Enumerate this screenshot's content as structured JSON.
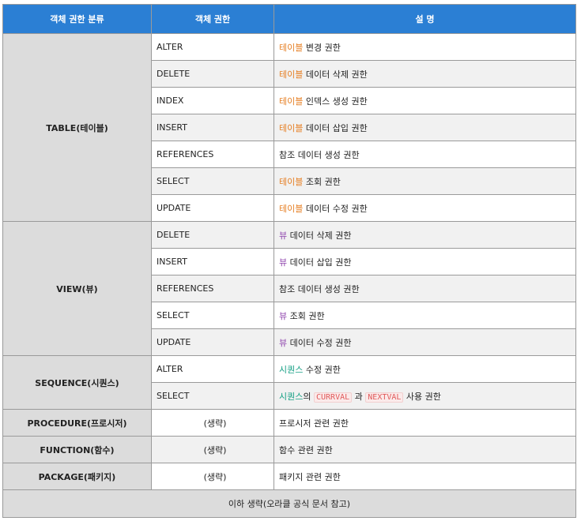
{
  "header": {
    "col1": "객체 권한 분류",
    "col2": "객체 권한",
    "col3": "설 명"
  },
  "colors": {
    "header_bg": "#2b7fd4",
    "table": "#e67e22",
    "view": "#8e44ad",
    "sequence": "#16a085",
    "code": "#e05a5a"
  },
  "table": {
    "category": "TABLE(테이블)",
    "rows": [
      {
        "priv": "ALTER",
        "hl": "테이블",
        "rest": " 변경 권한"
      },
      {
        "priv": "DELETE",
        "hl": "테이블",
        "rest": " 데이터 삭제 권한"
      },
      {
        "priv": "INDEX",
        "hl": "테이블",
        "rest": " 인덱스 생성 권한"
      },
      {
        "priv": "INSERT",
        "hl": "테이블",
        "rest": " 데이터 삽입 권한"
      },
      {
        "priv": "REFERENCES",
        "hl": "",
        "rest": "참조 데이터 생성 권한"
      },
      {
        "priv": "SELECT",
        "hl": "테이블",
        "rest": " 조회 권한"
      },
      {
        "priv": "UPDATE",
        "hl": "테이블",
        "rest": " 데이터 수정 권한"
      }
    ]
  },
  "view": {
    "category": "VIEW(뷰)",
    "rows": [
      {
        "priv": "DELETE",
        "hl": "뷰",
        "rest": " 데이터 삭제 권한"
      },
      {
        "priv": "INSERT",
        "hl": "뷰",
        "rest": " 데이터 삽입 권한"
      },
      {
        "priv": "REFERENCES",
        "hl": "",
        "rest": "참조 데이터 생성 권한"
      },
      {
        "priv": "SELECT",
        "hl": "뷰",
        "rest": " 조회 권한"
      },
      {
        "priv": "UPDATE",
        "hl": "뷰",
        "rest": " 데이터 수정 권한"
      }
    ]
  },
  "sequence": {
    "category": "SEQUENCE(시퀀스)",
    "rows": [
      {
        "priv": "ALTER",
        "hl": "시퀀스",
        "rest": " 수정 권한"
      },
      {
        "priv": "SELECT",
        "hl": "시퀀스",
        "mid": "의 ",
        "code1": "CURRVAL",
        "and": " 과 ",
        "code2": "NEXTVAL",
        "rest": " 사용 권한"
      }
    ]
  },
  "others": [
    {
      "category": "PROCEDURE(프로시저)",
      "priv": "(생략)",
      "desc": "프로시저 관련 권한"
    },
    {
      "category": "FUNCTION(함수)",
      "priv": "(생략)",
      "desc": "함수 관련 권한"
    },
    {
      "category": "PACKAGE(패키지)",
      "priv": "(생략)",
      "desc": "패키지 관련 권한"
    }
  ],
  "footer": "이하 생략(오라클 공식 문서 참고)"
}
